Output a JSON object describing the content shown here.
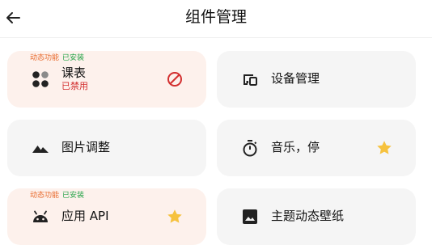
{
  "header": {
    "title": "组件管理",
    "back_icon": "back-arrow-icon"
  },
  "cards": [
    {
      "label": "课表",
      "status": "已禁用",
      "tag_dynamic": "动态功能",
      "tag_installed": "已安装",
      "icon": "grid-dots-icon",
      "action_icon": "disabled-icon",
      "highlighted": true
    },
    {
      "label": "设备管理",
      "icon": "devices-icon"
    },
    {
      "label": "图片调整",
      "icon": "landscape-icon"
    },
    {
      "label": "音乐，停",
      "icon": "timer-icon",
      "action_icon": "star-icon"
    },
    {
      "label": "应用 API",
      "tag_dynamic": "动态功能",
      "tag_installed": "已安装",
      "icon": "android-icon",
      "action_icon": "star-icon",
      "highlighted": true
    },
    {
      "label": "主题动态壁纸",
      "icon": "image-icon"
    }
  ],
  "colors": {
    "card_bg": "#f5f5f5",
    "card_highlight_bg": "#fdf1ec",
    "tag_dynamic": "#e8682a",
    "tag_installed": "#25a347",
    "status_disabled": "#d32f2f",
    "star": "#f6c23e"
  }
}
